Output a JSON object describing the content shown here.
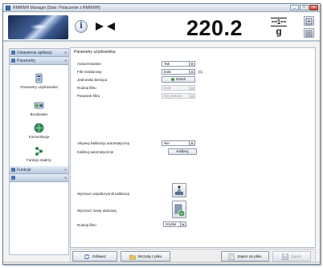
{
  "window": {
    "title": "RMWMH Manager  [Stan: Polaczenie z RMWMH]",
    "minimize": "_",
    "maximize": "□",
    "close": "x"
  },
  "header": {
    "info_label": "i",
    "weight_value": "220.2",
    "unit_top": "ꟷ1ꟷ",
    "unit": "g"
  },
  "sidebar": {
    "settings_header": "Ustawienia aplikacji",
    "params_header": "Parametry",
    "items": [
      {
        "label": "Parametry użytkownika"
      },
      {
        "label": "Bootloader"
      },
      {
        "label": "Komunikacje"
      },
      {
        "label": "Funkcje stałeży"
      }
    ],
    "functions_header": "Funkcje",
    "extra_header": ""
  },
  "content": {
    "title": "Parametry użytkownika",
    "fields": [
      {
        "label": "Autozerowanie",
        "value": "Tak"
      },
      {
        "label": "Filtr mediarowy",
        "value": "brak",
        "suffix": "[s]"
      },
      {
        "label": "Jednostka bieżąca",
        "button": "Zmień"
      },
      {
        "label": "Rodzaj filtru",
        "value": "brak"
      },
      {
        "label": "Parametr filtru",
        "value": "Wg statusu"
      }
    ],
    "auto_cal_label": "Aktywuj kalibrację automatyczną",
    "auto_cal_value": "Nie",
    "auto_cal_btn_label": "Kalibruj automatycznie",
    "auto_cal_btn": "Kalibruj",
    "factor_label": "Wyznacz współczynnik kalibracji",
    "tare_label": "Wyznacz masę startową",
    "filter_label": "Rodzaj filtru",
    "filter_value": "Szybki"
  },
  "bottom": {
    "refresh": "Odśwież",
    "load_file": "Wczytaj z pliku",
    "save_file": "Zapisz do pliku",
    "save": "Zapisz"
  },
  "colors": {
    "accent": "#3a6db3",
    "sidebar_header": "#bccbe0"
  }
}
